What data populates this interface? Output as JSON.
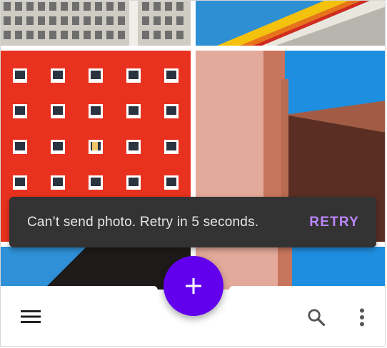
{
  "snackbar": {
    "message": "Can’t send photo. Retry in 5 seconds.",
    "action_label": "RETRY"
  },
  "fab": {
    "icon": "add-icon",
    "color": "#6200ee"
  },
  "bottom_bar": {
    "navigation_icon": "menu-icon",
    "actions": [
      "search-icon",
      "more-vertical-icon"
    ]
  },
  "colors": {
    "accent": "#6200ee",
    "action_text": "#bb86fc",
    "snackbar_bg": "#333333"
  }
}
